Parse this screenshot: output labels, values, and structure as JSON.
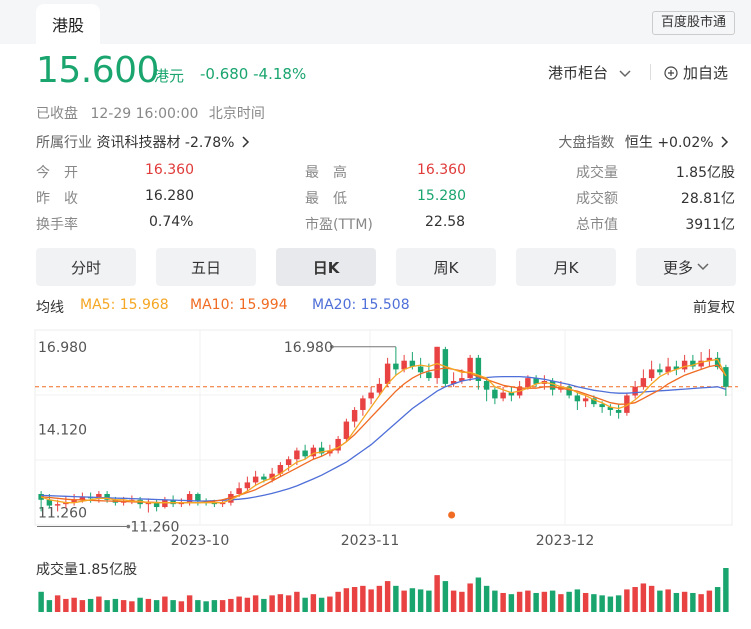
{
  "tabbar": {
    "tab": "港股",
    "badge": "百度股市通"
  },
  "quote": {
    "price": "15.600",
    "unit": "港元",
    "change": "-0.680",
    "pct": "-4.18%",
    "currency": "港币柜台",
    "add_fav": "加自选"
  },
  "status": {
    "state": "已收盘",
    "time": "12-29 16:00:00",
    "zone": "北京时间"
  },
  "industry": {
    "label": "所属行业",
    "name": "资讯科技器材",
    "pct": "-2.78%"
  },
  "market_index": {
    "label": "大盘指数",
    "name": "恒生",
    "pct": "+0.02%"
  },
  "stats": [
    {
      "label": "今　开",
      "value": "16.360",
      "color": "#e03a3a"
    },
    {
      "label": "最　高",
      "value": "16.360",
      "color": "#e03a3a"
    },
    {
      "label": "成交量",
      "value": "1.85亿股",
      "color": "#333333"
    },
    {
      "label": "昨　收",
      "value": "16.280",
      "color": "#333333"
    },
    {
      "label": "最　低",
      "value": "15.280",
      "color": "#1aa56f"
    },
    {
      "label": "成交额",
      "value": "28.81亿",
      "color": "#333333"
    },
    {
      "label": "换手率",
      "value": "0.74%",
      "color": "#333333"
    },
    {
      "label": "市盈(TTM)",
      "value": "22.58",
      "color": "#333333"
    },
    {
      "label": "总市值",
      "value": "3911亿",
      "color": "#333333"
    }
  ],
  "period_tabs": [
    "分时",
    "五日",
    "日K",
    "周K",
    "月K",
    "更多"
  ],
  "active_tab": "日K",
  "ma": {
    "label": "均线",
    "ma5": "MA5: 15.968",
    "ma10": "MA10: 15.994",
    "ma20": "MA20: 15.508",
    "adjust": "前复权"
  },
  "chart_data": {
    "type": "candlestick",
    "y_labels": [
      "16.980",
      "14.120",
      "11.260"
    ],
    "high_marker": "16.980",
    "low_marker": "11.260",
    "last_close": 15.6,
    "ylim": [
      10.83,
      17.56
    ],
    "x_labels": [
      "2023-10",
      "2023-11",
      "2023-12"
    ],
    "colors": {
      "up": "#e84242",
      "down": "#1aa56f",
      "ma5": "#f5a623",
      "ma10": "#f06b23",
      "ma20": "#4f6fd8"
    },
    "volume_label": "成交量1.85亿股",
    "candles": [
      [
        11.9,
        11.7,
        12.0,
        11.3
      ],
      [
        11.7,
        11.5,
        11.9,
        11.4
      ],
      [
        11.5,
        11.55,
        11.7,
        11.3
      ],
      [
        11.55,
        11.6,
        11.8,
        11.4
      ],
      [
        11.6,
        11.7,
        11.9,
        11.5
      ],
      [
        11.7,
        11.8,
        11.95,
        11.6
      ],
      [
        11.8,
        11.75,
        11.95,
        11.6
      ],
      [
        11.75,
        11.9,
        12.0,
        11.6
      ],
      [
        11.9,
        11.7,
        12.0,
        11.6
      ],
      [
        11.7,
        11.6,
        11.8,
        11.5
      ],
      [
        11.6,
        11.65,
        11.8,
        11.5
      ],
      [
        11.65,
        11.7,
        11.85,
        11.55
      ],
      [
        11.7,
        11.55,
        11.8,
        11.4
      ],
      [
        11.55,
        11.6,
        11.75,
        11.26
      ],
      [
        11.6,
        11.45,
        11.7,
        11.3
      ],
      [
        11.45,
        11.7,
        11.8,
        11.4
      ],
      [
        11.7,
        11.55,
        11.85,
        11.45
      ],
      [
        11.55,
        11.6,
        11.75,
        11.45
      ],
      [
        11.6,
        11.9,
        12.0,
        11.5
      ],
      [
        11.9,
        11.65,
        11.95,
        11.5
      ],
      [
        11.65,
        11.6,
        11.75,
        11.5
      ],
      [
        11.6,
        11.55,
        11.7,
        11.45
      ],
      [
        11.55,
        11.6,
        11.7,
        11.45
      ],
      [
        11.6,
        11.9,
        12.0,
        11.5
      ],
      [
        11.9,
        12.1,
        12.3,
        11.8
      ],
      [
        12.1,
        12.3,
        12.5,
        12.0
      ],
      [
        12.3,
        12.5,
        12.7,
        12.2
      ],
      [
        12.5,
        12.4,
        12.6,
        12.3
      ],
      [
        12.4,
        12.6,
        12.8,
        12.3
      ],
      [
        12.6,
        12.9,
        13.0,
        12.5
      ],
      [
        12.9,
        13.1,
        13.2,
        12.7
      ],
      [
        13.1,
        13.4,
        13.5,
        12.9
      ],
      [
        13.4,
        13.2,
        13.6,
        13.1
      ],
      [
        13.2,
        13.5,
        13.6,
        13.1
      ],
      [
        13.5,
        13.3,
        13.7,
        13.2
      ],
      [
        13.3,
        13.4,
        13.6,
        13.2
      ],
      [
        13.4,
        13.8,
        13.9,
        13.3
      ],
      [
        13.8,
        14.4,
        14.5,
        13.7
      ],
      [
        14.4,
        14.8,
        14.9,
        14.2
      ],
      [
        14.8,
        15.2,
        15.3,
        14.6
      ],
      [
        15.2,
        15.4,
        15.6,
        15.0
      ],
      [
        15.4,
        15.7,
        15.9,
        15.3
      ],
      [
        15.7,
        16.4,
        16.6,
        15.6
      ],
      [
        16.4,
        16.2,
        16.98,
        16.0
      ],
      [
        16.2,
        16.5,
        16.7,
        16.1
      ],
      [
        16.5,
        16.3,
        16.8,
        16.2
      ],
      [
        16.3,
        16.1,
        16.6,
        15.9
      ],
      [
        16.1,
        15.9,
        16.4,
        15.8
      ],
      [
        15.9,
        16.98,
        16.98,
        15.7
      ],
      [
        16.9,
        15.7,
        16.98,
        15.6
      ],
      [
        15.7,
        15.8,
        16.1,
        15.6
      ],
      [
        15.8,
        15.9,
        16.2,
        15.7
      ],
      [
        15.9,
        16.6,
        16.7,
        15.8
      ],
      [
        16.6,
        15.8,
        16.7,
        15.5
      ],
      [
        15.8,
        15.5,
        15.9,
        15.1
      ],
      [
        15.5,
        15.2,
        15.6,
        15.0
      ],
      [
        15.2,
        15.4,
        15.6,
        15.1
      ],
      [
        15.4,
        15.3,
        15.6,
        15.1
      ],
      [
        15.3,
        15.6,
        15.8,
        15.2
      ],
      [
        15.6,
        15.9,
        16.0,
        15.5
      ],
      [
        15.9,
        15.7,
        16.0,
        15.6
      ],
      [
        15.7,
        15.8,
        16.0,
        15.5
      ],
      [
        15.8,
        15.5,
        15.9,
        15.3
      ],
      [
        15.5,
        15.6,
        15.8,
        15.4
      ],
      [
        15.6,
        15.3,
        15.7,
        15.2
      ],
      [
        15.3,
        15.1,
        15.4,
        14.8
      ],
      [
        15.1,
        15.2,
        15.3,
        14.9
      ],
      [
        15.2,
        15.0,
        15.3,
        14.9
      ],
      [
        15.0,
        14.9,
        15.1,
        14.7
      ],
      [
        14.9,
        14.8,
        15.0,
        14.6
      ],
      [
        14.8,
        14.7,
        15.0,
        14.5
      ],
      [
        14.7,
        15.3,
        15.4,
        14.6
      ],
      [
        15.3,
        15.6,
        15.8,
        15.2
      ],
      [
        15.6,
        15.9,
        16.2,
        15.5
      ],
      [
        15.9,
        16.2,
        16.5,
        15.8
      ],
      [
        16.2,
        16.1,
        16.4,
        16.0
      ],
      [
        16.1,
        16.3,
        16.6,
        16.0
      ],
      [
        16.3,
        16.2,
        16.5,
        16.0
      ],
      [
        16.2,
        16.5,
        16.7,
        16.1
      ],
      [
        16.5,
        16.3,
        16.7,
        16.2
      ],
      [
        16.3,
        16.5,
        16.8,
        16.2
      ],
      [
        16.5,
        16.6,
        16.9,
        16.3
      ],
      [
        16.6,
        16.28,
        16.8,
        16.2
      ],
      [
        16.28,
        15.6,
        16.36,
        15.28
      ]
    ],
    "ma5": [
      11.8,
      11.7,
      11.65,
      11.6,
      11.6,
      11.65,
      11.7,
      11.75,
      11.75,
      11.7,
      11.7,
      11.65,
      11.65,
      11.6,
      11.6,
      11.6,
      11.6,
      11.6,
      11.6,
      11.6,
      11.6,
      11.6,
      11.6,
      11.7,
      11.85,
      12.0,
      12.2,
      12.35,
      12.45,
      12.6,
      12.8,
      13.0,
      13.1,
      13.3,
      13.35,
      13.4,
      13.5,
      13.7,
      14.1,
      14.5,
      14.9,
      15.3,
      15.7,
      16.0,
      16.2,
      16.3,
      16.35,
      16.3,
      16.4,
      16.3,
      16.2,
      16.1,
      16.1,
      16.0,
      15.9,
      15.6,
      15.5,
      15.4,
      15.45,
      15.55,
      15.7,
      15.75,
      15.7,
      15.6,
      15.55,
      15.4,
      15.3,
      15.15,
      15.05,
      14.9,
      14.85,
      14.95,
      15.15,
      15.4,
      15.7,
      15.95,
      16.1,
      16.2,
      16.3,
      16.35,
      16.45,
      16.5,
      16.55,
      15.97
    ],
    "ma10": [
      11.8,
      11.78,
      11.75,
      11.72,
      11.7,
      11.7,
      11.68,
      11.67,
      11.66,
      11.65,
      11.64,
      11.63,
      11.62,
      11.62,
      11.61,
      11.6,
      11.6,
      11.6,
      11.6,
      11.6,
      11.62,
      11.65,
      11.7,
      11.78,
      11.85,
      11.95,
      12.05,
      12.2,
      12.35,
      12.5,
      12.65,
      12.8,
      12.95,
      13.1,
      13.2,
      13.35,
      13.5,
      13.7,
      13.95,
      14.25,
      14.55,
      14.85,
      15.15,
      15.45,
      15.7,
      15.9,
      16.05,
      16.15,
      16.2,
      16.25,
      16.2,
      16.15,
      16.05,
      15.95,
      15.85,
      15.75,
      15.65,
      15.6,
      15.55,
      15.55,
      15.55,
      15.6,
      15.6,
      15.55,
      15.5,
      15.45,
      15.35,
      15.25,
      15.15,
      15.05,
      15.0,
      15.0,
      15.05,
      15.2,
      15.35,
      15.5,
      15.7,
      15.85,
      16.0,
      16.1,
      16.2,
      16.3,
      16.35,
      15.99
    ],
    "ma20": [
      11.85,
      11.84,
      11.83,
      11.82,
      11.81,
      11.8,
      11.79,
      11.78,
      11.77,
      11.76,
      11.75,
      11.74,
      11.73,
      11.72,
      11.71,
      11.7,
      11.69,
      11.68,
      11.67,
      11.66,
      11.66,
      11.67,
      11.68,
      11.7,
      11.72,
      11.75,
      11.8,
      11.86,
      11.92,
      12.0,
      12.08,
      12.18,
      12.3,
      12.42,
      12.55,
      12.7,
      12.85,
      13.0,
      13.2,
      13.4,
      13.6,
      13.85,
      14.1,
      14.35,
      14.6,
      14.85,
      15.05,
      15.25,
      15.45,
      15.6,
      15.7,
      15.8,
      15.85,
      15.9,
      15.92,
      15.94,
      15.95,
      15.95,
      15.95,
      15.93,
      15.9,
      15.86,
      15.8,
      15.74,
      15.68,
      15.6,
      15.54,
      15.48,
      15.44,
      15.4,
      15.38,
      15.38,
      15.4,
      15.42,
      15.44,
      15.46,
      15.48,
      15.5,
      15.52,
      15.54,
      15.56,
      15.58,
      15.6,
      15.51
    ],
    "volumes": [
      0.85,
      0.5,
      0.7,
      0.55,
      0.6,
      0.5,
      0.55,
      0.65,
      0.5,
      0.55,
      0.5,
      0.45,
      0.6,
      0.55,
      0.5,
      0.65,
      0.5,
      0.45,
      0.7,
      0.5,
      0.45,
      0.5,
      0.5,
      0.55,
      0.65,
      0.6,
      0.7,
      0.55,
      0.7,
      0.75,
      0.7,
      0.85,
      0.6,
      0.75,
      0.6,
      0.65,
      0.85,
      1.0,
      1.05,
      1.1,
      0.95,
      1.1,
      1.3,
      1.1,
      0.9,
      1.0,
      0.95,
      0.9,
      1.55,
      1.3,
      0.9,
      0.85,
      1.2,
      1.45,
      1.1,
      0.9,
      0.8,
      0.75,
      0.85,
      0.9,
      0.8,
      0.85,
      0.9,
      0.75,
      0.85,
      0.95,
      0.8,
      0.75,
      0.7,
      0.65,
      0.7,
      0.95,
      1.05,
      1.2,
      1.1,
      0.9,
      0.95,
      0.8,
      0.85,
      0.8,
      0.75,
      0.9,
      1.05,
      1.85
    ]
  }
}
